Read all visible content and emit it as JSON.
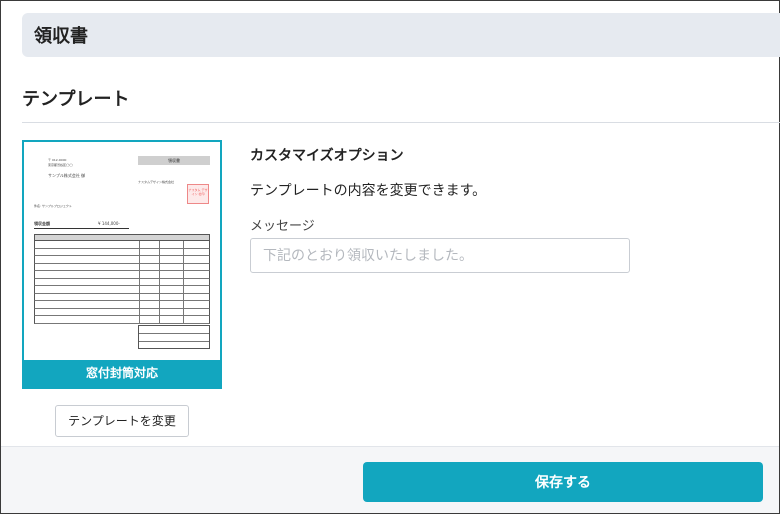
{
  "header": {
    "title": "領収書"
  },
  "section": {
    "title": "テンプレート"
  },
  "template": {
    "caption": "窓付封筒対応",
    "preview": {
      "doc_title": "領収書",
      "amount": "¥ 144,000-",
      "lines": [
        "〒 012-0000",
        "東京都渋谷区◯◯",
        "サンプル株式会社 御",
        "件名: サンプルプロジェクト",
        "領収金額",
        "ナスタムデザイン株式会社"
      ],
      "stamp": "ナスタム デザイン 社印"
    },
    "change_label": "テンプレートを変更"
  },
  "options": {
    "title": "カスタマイズオプション",
    "description": "テンプレートの内容を変更できます。",
    "message_label": "メッセージ",
    "message_placeholder": "下記のとおり領収いたしました。",
    "message_value": ""
  },
  "footer": {
    "save_label": "保存する"
  },
  "colors": {
    "accent": "#12a6bf",
    "header_bg": "#e6eaf0"
  }
}
